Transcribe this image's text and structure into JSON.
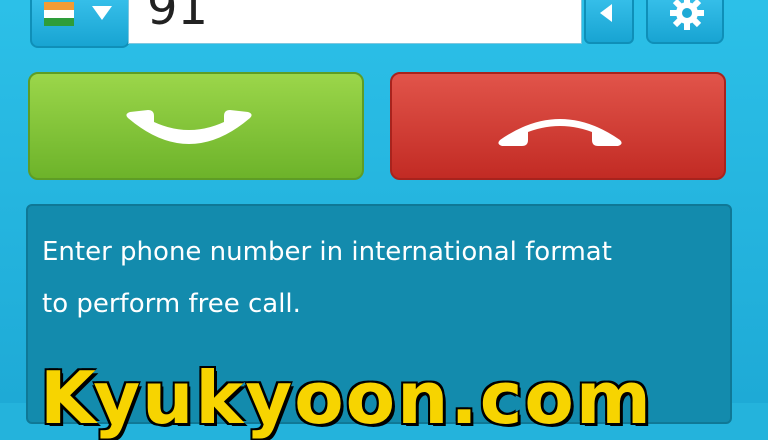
{
  "dialer": {
    "country_flag": "flag-icon",
    "phone_number": "91",
    "backspace_icon": "backspace-arrow-icon",
    "settings_icon": "gear-icon"
  },
  "actions": {
    "call_icon": "phone-handset-icon",
    "hangup_icon": "phone-hangup-icon",
    "call_color": "#7cc234",
    "hangup_color": "#d1382f"
  },
  "info": {
    "message_line1": "Enter phone number in international format",
    "message_line2": "to perform free call."
  },
  "watermark": {
    "text": "Kyukyoon.com"
  }
}
